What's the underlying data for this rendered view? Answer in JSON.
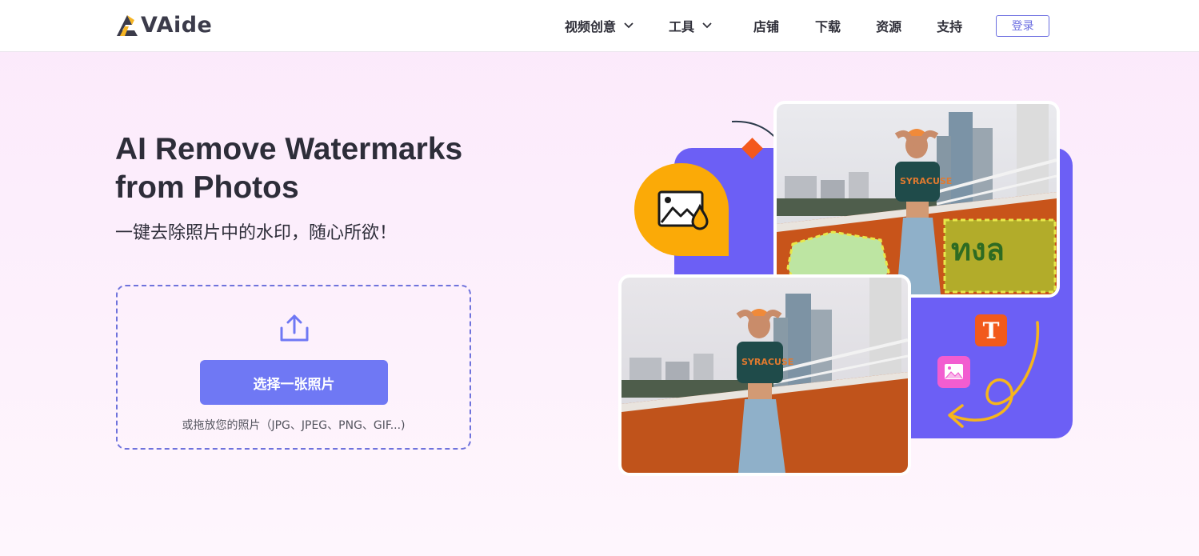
{
  "header": {
    "logo_text": "VAide",
    "nav": [
      {
        "label": "视频创意",
        "has_dropdown": true
      },
      {
        "label": "工具",
        "has_dropdown": true
      },
      {
        "label": "店铺",
        "has_dropdown": false
      },
      {
        "label": "下载",
        "has_dropdown": false
      },
      {
        "label": "资源",
        "has_dropdown": false
      },
      {
        "label": "支持",
        "has_dropdown": false
      }
    ],
    "login_label": "登录"
  },
  "hero": {
    "title": "AI Remove Watermarks from Photos",
    "subtitle": "一键去除照片中的水印，随心所欲！",
    "upload": {
      "button_label": "选择一张照片",
      "hint": "或拖放您的照片（JPG、JPEG、PNG、GIF...)"
    }
  },
  "illustration": {
    "text_badge_glyph": "T",
    "colors": {
      "accent_purple": "#6c5ff5",
      "accent_orange": "#fbaa07",
      "badge_red": "#f25a1c",
      "badge_pink": "#f25dd0",
      "button_blue": "#6f78f4",
      "upload_border": "#6f73dc"
    }
  }
}
